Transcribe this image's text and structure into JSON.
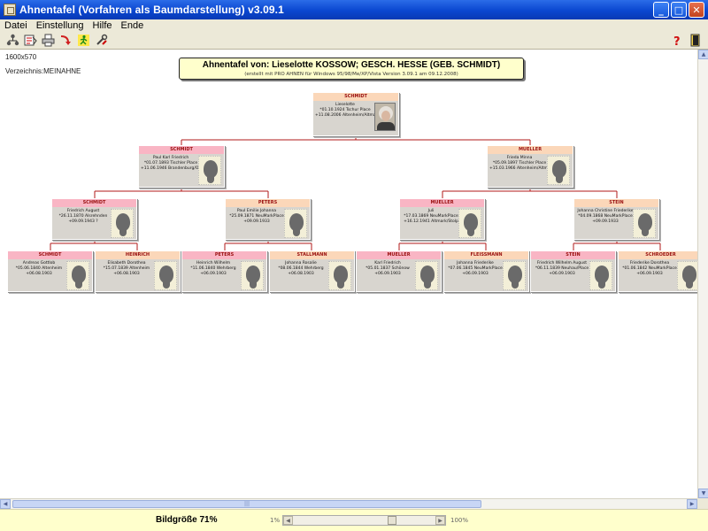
{
  "window": {
    "title": "Ahnentafel (Vorfahren als Baumdarstellung) v3.09.1",
    "buttons": [
      "_",
      "□",
      "✕"
    ]
  },
  "menu": [
    "Datei",
    "Einstellung",
    "Hilfe",
    "Ende"
  ],
  "info": {
    "size": "1600x570",
    "directory": "Verzeichnis:MEINAHNE"
  },
  "header": {
    "title": "Ahnentafel von: Lieselotte  KOSSOW; GESCH. HESSE (GEB. SCHMIDT)",
    "subtitle": "(erstellt mit PRO AHNEN für Windows 95/98/Me/XP/Vista Version 3.09.1 am 09.12.2008)"
  },
  "persons": [
    {
      "id": "p1",
      "surname": "SCHMIDT",
      "lines": [
        "Lieselotte",
        "*01.10.1924 Tschur Place",
        "+11.08.2006 Altenheim/Altmark"
      ],
      "sex": "w",
      "photo": true
    },
    {
      "id": "p2",
      "surname": "SCHMIDT",
      "lines": [
        "Paul Karl Friedrich",
        "*01.07.1893 Tischler Place",
        "+11.06.1946 Brandenburg/Ostb"
      ],
      "sex": "m"
    },
    {
      "id": "p3",
      "surname": "MUELLER",
      "lines": [
        "Frieda Minna",
        "*05.09.1897 Tischler Place",
        "+15.03.1966 Altenheim/Altmark"
      ],
      "sex": "w"
    },
    {
      "id": "p4",
      "surname": "SCHMIDT",
      "lines": [
        "Friedrich August",
        "*26.11.1870 Alsrehnden",
        "+09.09.1943 ?"
      ],
      "sex": "m"
    },
    {
      "id": "p5",
      "surname": "PETERS",
      "lines": [
        "Paul Emilie Johanna",
        "*25.09.1871 NeuMarkPlace",
        "+09.09.1933"
      ],
      "sex": "w"
    },
    {
      "id": "p6",
      "surname": "MUELLER",
      "lines": [
        "Juli",
        "*17.03.1869 NeuMarkPlace",
        "+16.12.1941 Altmark/Stolp"
      ],
      "sex": "m"
    },
    {
      "id": "p7",
      "surname": "STEIN",
      "lines": [
        "Johanna Christine Friederike",
        "*04.09.1868 NeuMarkPlace",
        "+09.09.1933"
      ],
      "sex": "w"
    },
    {
      "id": "p8",
      "surname": "SCHMIDT",
      "lines": [
        "Andreas Gottlob",
        "*05.06.1840 Altenheim",
        "+06.08.1903"
      ],
      "sex": "m"
    },
    {
      "id": "p9",
      "surname": "HEINRICH",
      "lines": [
        "Elisabeth Dorothea",
        "*15.07.1839 Altenheim",
        "+06.08.1903"
      ],
      "sex": "w"
    },
    {
      "id": "p10",
      "surname": "PETERS",
      "lines": [
        "Heinrich Wilhelm",
        "*11.06.1840 Wehrberg",
        "+06.09.1903"
      ],
      "sex": "m"
    },
    {
      "id": "p11",
      "surname": "STALLMANN",
      "lines": [
        "Johanna Rosalie",
        "*08.06.1844 Wehrberg",
        "+06.08.1903"
      ],
      "sex": "w"
    },
    {
      "id": "p12",
      "surname": "MUELLER",
      "lines": [
        "Karl Friedrich",
        "*05.01.1837 Schönow",
        "+06.09.1903"
      ],
      "sex": "m"
    },
    {
      "id": "p13",
      "surname": "FLEISSMANN",
      "lines": [
        "Johanna Friederike",
        "*07.06.1845 NeuMarkPlace",
        "+06.09.1903"
      ],
      "sex": "w"
    },
    {
      "id": "p14",
      "surname": "STEIN",
      "lines": [
        "Friedrich Wilhelm August",
        "*06.11.1839 Neuhau/Place",
        "+06.09.1903"
      ],
      "sex": "m"
    },
    {
      "id": "p15",
      "surname": "SCHROEDER",
      "lines": [
        "Friederike Dorothea",
        "*01.06.1842 NeuMarkPlace",
        "+06.09.1903"
      ],
      "sex": "w"
    }
  ],
  "status": {
    "zoom_label": "Bildgröße 71%",
    "zoom_min": "1%",
    "zoom_max": "100%",
    "zoom_value": 71
  },
  "scrollbar": {
    "grip": "|||"
  }
}
